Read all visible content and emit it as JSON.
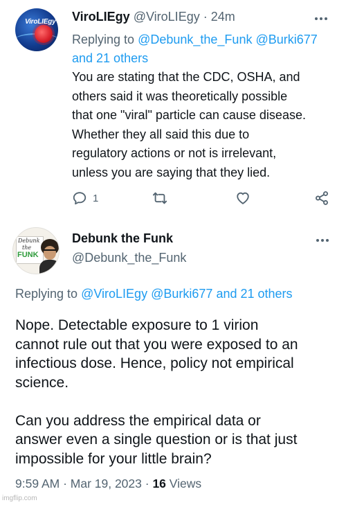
{
  "reply_tweet": {
    "display_name": "ViroLIEgy",
    "handle": "@ViroLIEgy",
    "separator": "·",
    "time": "24m",
    "avatar_text": "ViroLIEgy",
    "replying_prefix": "Replying to",
    "replying_users": [
      "@Debunk_the_Funk",
      "@Burki677"
    ],
    "replying_others": "and 21 others",
    "text_lines": [
      "You are stating that the CDC, OSHA, and",
      "others said it was theoretically possible",
      "that one \"viral\" particle can cause disease.",
      "Whether they all said this due to",
      "regulatory actions or not is irrelevant,",
      "unless you are saying that they lied."
    ],
    "actions": {
      "reply_count": "1",
      "reply_icon": "comment-icon",
      "retweet_icon": "retweet-icon",
      "like_icon": "heart-icon",
      "share_icon": "share-icon"
    }
  },
  "main_tweet": {
    "display_name": "Debunk the Funk",
    "handle": "@Debunk_the_Funk",
    "avatar_text": [
      "Debunk",
      "the",
      "FUNK"
    ],
    "replying_prefix": "Replying to",
    "replying_users": [
      "@ViroLIEgy",
      "@Burki677"
    ],
    "replying_others": "and 21 others",
    "paragraphs": [
      [
        "Nope. Detectable exposure to 1 virion",
        "cannot rule out that you were exposed to an",
        "infectious dose. Hence, policy not empirical",
        "science."
      ],
      [
        "Can you address the empirical data or",
        "answer even a single question or is that just",
        "impossible for your little brain?"
      ]
    ],
    "timestamp": "9:59 AM · Mar 19, 2023 ·",
    "views_count": "16",
    "views_label": "Views"
  },
  "watermark": "imgflip.com",
  "colors": {
    "text_primary": "#0f1419",
    "text_secondary": "#536471",
    "link": "#1d9bf0"
  }
}
